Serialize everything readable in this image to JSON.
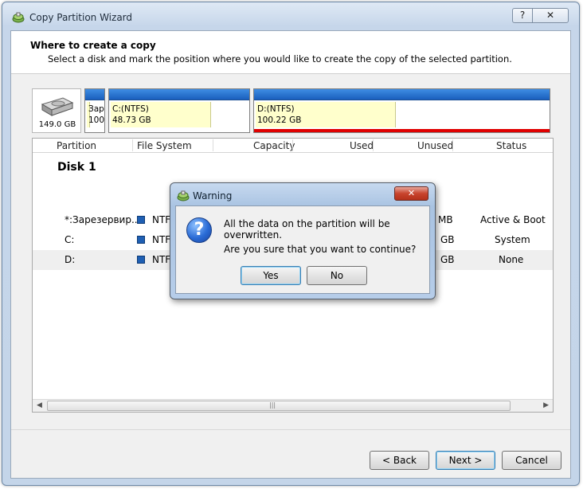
{
  "window": {
    "title": "Copy Partition Wizard",
    "help_label": "?",
    "close_label": "✕"
  },
  "header": {
    "title": "Where to create a copy",
    "subtitle": "Select a disk and mark the position where you would like to create the copy of the selected partition."
  },
  "diskmap": {
    "disk_size": "149.0 GB",
    "partitions": [
      {
        "label_line1": "Зар",
        "label_line2": "100"
      },
      {
        "label_line1": "C:(NTFS)",
        "label_line2": "48.73 GB"
      },
      {
        "label_line1": "D:(NTFS)",
        "label_line2": "100.22 GB"
      }
    ]
  },
  "list": {
    "columns": [
      "Partition",
      "File System",
      "Capacity",
      "Used",
      "Unused",
      "Status"
    ],
    "disk_label": "Disk 1",
    "rows": [
      {
        "partition": "*:Зарезервир...",
        "fs": "NTFS",
        "unused": "MB",
        "status": "Active & Boot"
      },
      {
        "partition": "C:",
        "fs": "NTFS",
        "unused": "GB",
        "status": "System"
      },
      {
        "partition": "D:",
        "fs": "NTFS",
        "unused": "GB",
        "status": "None"
      }
    ],
    "scroll_left": "◀",
    "scroll_right": "▶",
    "scroll_grip": "|||"
  },
  "buttons": {
    "back": "< Back",
    "next": "Next >",
    "cancel": "Cancel"
  },
  "dialog": {
    "title": "Warning",
    "close_label": "✕",
    "icon_glyph": "?",
    "message1": "All the data on the partition will be overwritten.",
    "message2": "Are you sure that you want to continue?",
    "yes": "Yes",
    "no": "No"
  },
  "colors": {
    "partition_bar": "#1a5fbd",
    "partition_fill": "#ffffcc",
    "selected_marker": "#e00000"
  }
}
